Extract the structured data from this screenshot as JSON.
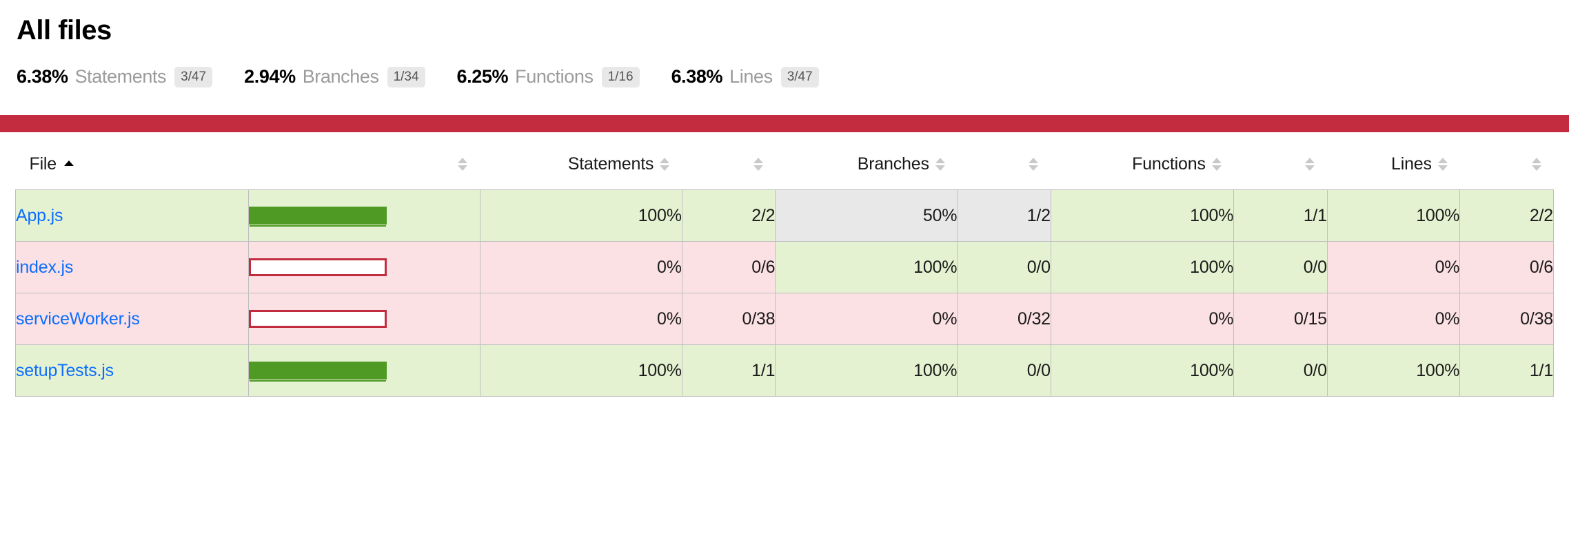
{
  "header": {
    "title": "All files",
    "summary": [
      {
        "pct": "6.38%",
        "label": "Statements",
        "fraction": "3/47"
      },
      {
        "pct": "2.94%",
        "label": "Branches",
        "fraction": "1/34"
      },
      {
        "pct": "6.25%",
        "label": "Functions",
        "fraction": "1/16"
      },
      {
        "pct": "6.38%",
        "label": "Lines",
        "fraction": "3/47"
      }
    ]
  },
  "status_bar": {
    "color": "#c32b3e",
    "level": "low"
  },
  "table": {
    "columns": [
      {
        "key": "file",
        "label": "File",
        "sorted": "asc"
      },
      {
        "key": "pic",
        "label": "",
        "sorted": "none"
      },
      {
        "key": "statements_pct",
        "label": "Statements",
        "sorted": "none"
      },
      {
        "key": "statements_raw",
        "label": "",
        "sorted": "none"
      },
      {
        "key": "branches_pct",
        "label": "Branches",
        "sorted": "none"
      },
      {
        "key": "branches_raw",
        "label": "",
        "sorted": "none"
      },
      {
        "key": "functions_pct",
        "label": "Functions",
        "sorted": "none"
      },
      {
        "key": "functions_raw",
        "label": "",
        "sorted": "none"
      },
      {
        "key": "lines_pct",
        "label": "Lines",
        "sorted": "none"
      },
      {
        "key": "lines_raw",
        "label": "",
        "sorted": "none"
      }
    ],
    "rows": [
      {
        "file": "App.js",
        "bar": {
          "percent": 100,
          "level": "high"
        },
        "statements": {
          "pct": "100%",
          "raw": "2/2",
          "level": "high"
        },
        "branches": {
          "pct": "50%",
          "raw": "1/2",
          "level": "medium"
        },
        "functions": {
          "pct": "100%",
          "raw": "1/1",
          "level": "high"
        },
        "lines": {
          "pct": "100%",
          "raw": "2/2",
          "level": "high"
        }
      },
      {
        "file": "index.js",
        "bar": {
          "percent": 0,
          "level": "low"
        },
        "statements": {
          "pct": "0%",
          "raw": "0/6",
          "level": "low"
        },
        "branches": {
          "pct": "100%",
          "raw": "0/0",
          "level": "high"
        },
        "functions": {
          "pct": "100%",
          "raw": "0/0",
          "level": "high"
        },
        "lines": {
          "pct": "0%",
          "raw": "0/6",
          "level": "low"
        }
      },
      {
        "file": "serviceWorker.js",
        "bar": {
          "percent": 0,
          "level": "low"
        },
        "statements": {
          "pct": "0%",
          "raw": "0/38",
          "level": "low"
        },
        "branches": {
          "pct": "0%",
          "raw": "0/32",
          "level": "low"
        },
        "functions": {
          "pct": "0%",
          "raw": "0/15",
          "level": "low"
        },
        "lines": {
          "pct": "0%",
          "raw": "0/38",
          "level": "low"
        }
      },
      {
        "file": "setupTests.js",
        "bar": {
          "percent": 100,
          "level": "high"
        },
        "statements": {
          "pct": "100%",
          "raw": "1/1",
          "level": "high"
        },
        "branches": {
          "pct": "100%",
          "raw": "0/0",
          "level": "high"
        },
        "functions": {
          "pct": "100%",
          "raw": "0/0",
          "level": "high"
        },
        "lines": {
          "pct": "100%",
          "raw": "1/1",
          "level": "high"
        }
      }
    ]
  },
  "colors": {
    "high_bg": "#e5f2d1",
    "medium_bg": "#e8e8e8",
    "low_bg": "#fbe0e4",
    "bar_high": "#4f9a24",
    "bar_low_border": "#c32b3e",
    "link": "#0d6efd",
    "status_bar": "#c32b3e"
  }
}
